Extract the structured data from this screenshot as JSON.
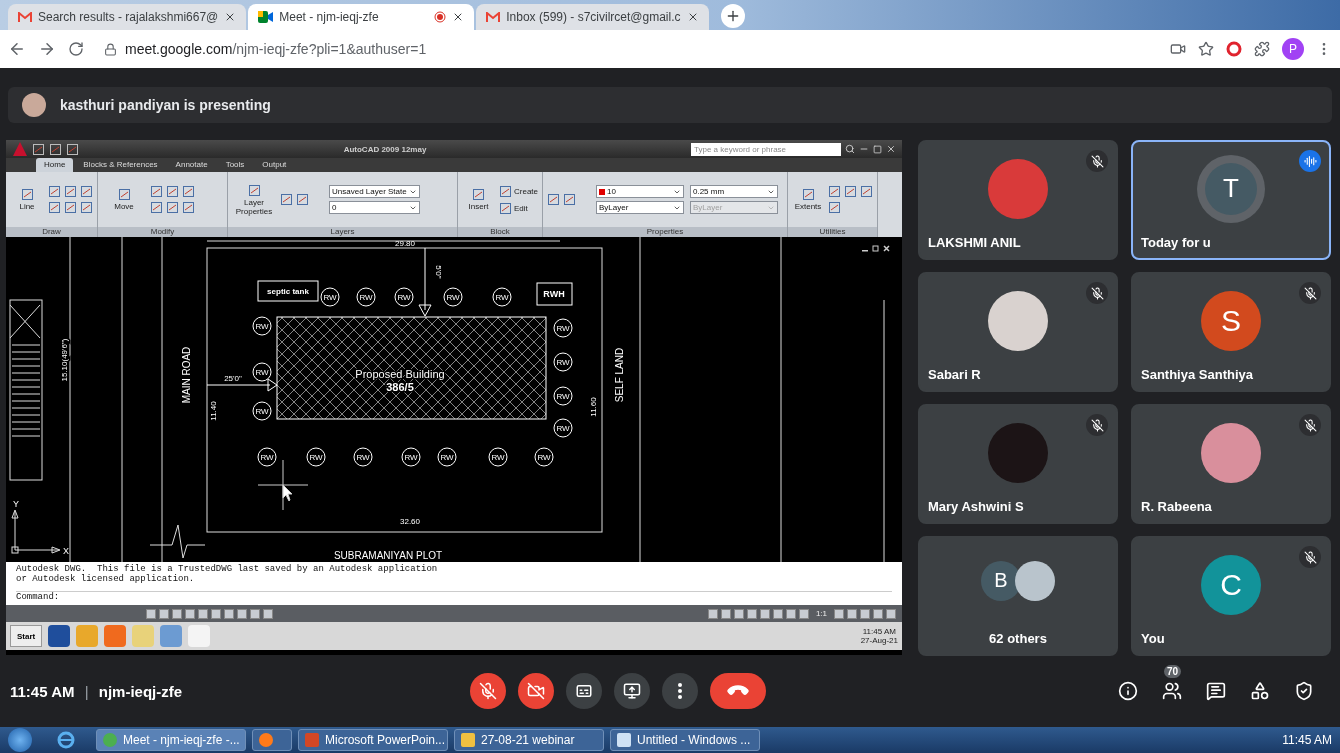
{
  "browser": {
    "tabs": [
      {
        "title": "Search results - rajalakshmi667@",
        "kind": "mail",
        "selected": false,
        "recording": false
      },
      {
        "title": "Meet - njm-ieqj-zfe",
        "kind": "meet",
        "selected": true,
        "recording": true
      },
      {
        "title": "Inbox (599) - s7civilrcet@gmail.c",
        "kind": "mail",
        "selected": false,
        "recording": false
      }
    ],
    "url": {
      "host": "meet.google.com",
      "path": "/njm-ieqj-zfe?pli=1&authuser=1"
    },
    "profile": "P"
  },
  "presenting": {
    "text": "kasthuri pandiyan is presenting"
  },
  "autocad": {
    "title": "AutoCAD 2009 12may",
    "search_placeholder": "Type a keyword or phrase",
    "ribbon_tabs": [
      {
        "label": "Home",
        "selected": true
      },
      {
        "label": "Blocks & References",
        "selected": false
      },
      {
        "label": "Annotate",
        "selected": false
      },
      {
        "label": "Tools",
        "selected": false
      },
      {
        "label": "Output",
        "selected": false
      }
    ],
    "panels": [
      {
        "title": "Draw",
        "buttons": [
          {
            "label": "Line",
            "kind": "large"
          }
        ]
      },
      {
        "title": "Modify",
        "buttons": [
          {
            "label": "Move",
            "kind": "large"
          }
        ]
      },
      {
        "title": "Layers",
        "buttons": [
          {
            "label": "Layer Properties",
            "kind": "large"
          }
        ],
        "fields": [
          {
            "value": "Unsaved Layer State",
            "disabled": false
          },
          {
            "value": "0",
            "disabled": false
          }
        ]
      },
      {
        "title": "Block",
        "buttons": [
          {
            "label": "Insert",
            "kind": "large"
          },
          {
            "label": "Create",
            "kind": "small"
          },
          {
            "label": "Edit",
            "kind": "small"
          }
        ]
      },
      {
        "title": "Properties",
        "fields": [
          {
            "value": "10",
            "disabled": false,
            "color": "#e00000"
          },
          {
            "value": "0.25 mm",
            "disabled": false
          },
          {
            "value": "ByLayer",
            "disabled": false
          },
          {
            "value": "ByLayer",
            "disabled": true
          }
        ]
      },
      {
        "title": "Utilities",
        "buttons": [
          {
            "label": "Extents",
            "kind": "large"
          }
        ]
      }
    ],
    "drawing": {
      "top_dimension": "29.80",
      "bottom_dimension": "32.60",
      "left_dimension": "11.40",
      "right_dimension": "11.60",
      "front_setback": "25'0\"",
      "top_setback": "5'0\"",
      "side_dimension": "15.10(49'6\")",
      "main_road": "MAIN ROAD",
      "self_land": "SELF LAND",
      "bottom_plot": "SUBRAMANIYAN PLOT",
      "septic_tank": "septic tank",
      "rwh": "RWH",
      "building_title": "Proposed Building",
      "building_number": "386/5",
      "rw_markers": [
        "RW",
        "RW",
        "RW",
        "RW",
        "RW",
        "RW",
        "RW",
        "RW",
        "RW",
        "RW",
        "RW",
        "RW",
        "RW",
        "RW",
        "RW",
        "RW",
        "RW",
        "RW",
        "RW"
      ],
      "axis_y": "Y",
      "axis_x": "X"
    },
    "command_history": [
      "Autodesk DWG.  This file is a TrustedDWG last saved by an Autodesk application",
      "or Autodesk licensed application."
    ],
    "command_prompt": "Command:",
    "annotation_scale": "1:1",
    "taskbar": {
      "start": "Start",
      "time": "11:45 AM",
      "date": "27-Aug-21"
    }
  },
  "participants": [
    {
      "name": "LAKSHMI ANIL",
      "kind": "photo",
      "color": "#d93a3a",
      "muted": true,
      "speaking": false
    },
    {
      "name": "Today for u",
      "kind": "initial",
      "initial": "T",
      "color": "#455a64",
      "muted": false,
      "speaking": true
    },
    {
      "name": "Sabari R",
      "kind": "photo",
      "color": "#d9d2cf",
      "muted": true,
      "speaking": false
    },
    {
      "name": "Santhiya Santhiya",
      "kind": "initial",
      "initial": "S",
      "color": "#d24a1e",
      "muted": true,
      "speaking": false
    },
    {
      "name": "Mary Ashwini S",
      "kind": "photo",
      "color": "#1c1416",
      "muted": true,
      "speaking": false
    },
    {
      "name": "R. Rabeena",
      "kind": "photo",
      "color": "#d98f9c",
      "muted": true,
      "speaking": false
    },
    {
      "name": "62 others",
      "kind": "group",
      "initial": "B",
      "color": "#455a64",
      "muted": false,
      "speaking": false
    },
    {
      "name": "You",
      "kind": "initial",
      "initial": "C",
      "color": "#12939a",
      "muted": true,
      "speaking": false
    }
  ],
  "meeting": {
    "time": "11:45 AM",
    "separator": "|",
    "code": "njm-ieqj-zfe"
  },
  "controls": [
    {
      "kind": "mic",
      "on": false
    },
    {
      "kind": "camera",
      "on": false
    },
    {
      "kind": "captions",
      "on": false
    },
    {
      "kind": "present"
    },
    {
      "kind": "more"
    },
    {
      "kind": "leave"
    }
  ],
  "side_icons": [
    {
      "kind": "info"
    },
    {
      "kind": "people",
      "badge": "70"
    },
    {
      "kind": "chat"
    },
    {
      "kind": "activities"
    },
    {
      "kind": "host"
    }
  ],
  "windows_taskbar": {
    "items": [
      {
        "kind": "chrome",
        "label": "Meet - njm-ieqj-zfe -...",
        "selected": true
      },
      {
        "kind": "firefox",
        "selected": false
      },
      {
        "kind": "powerpoint",
        "label": "Microsoft PowerPoin...",
        "selected": false
      },
      {
        "kind": "folder",
        "label": "27-08-21 webinar",
        "selected": false
      },
      {
        "kind": "window",
        "label": "Untitled - Windows ...",
        "selected": false
      }
    ],
    "clock": "11:45 AM"
  }
}
